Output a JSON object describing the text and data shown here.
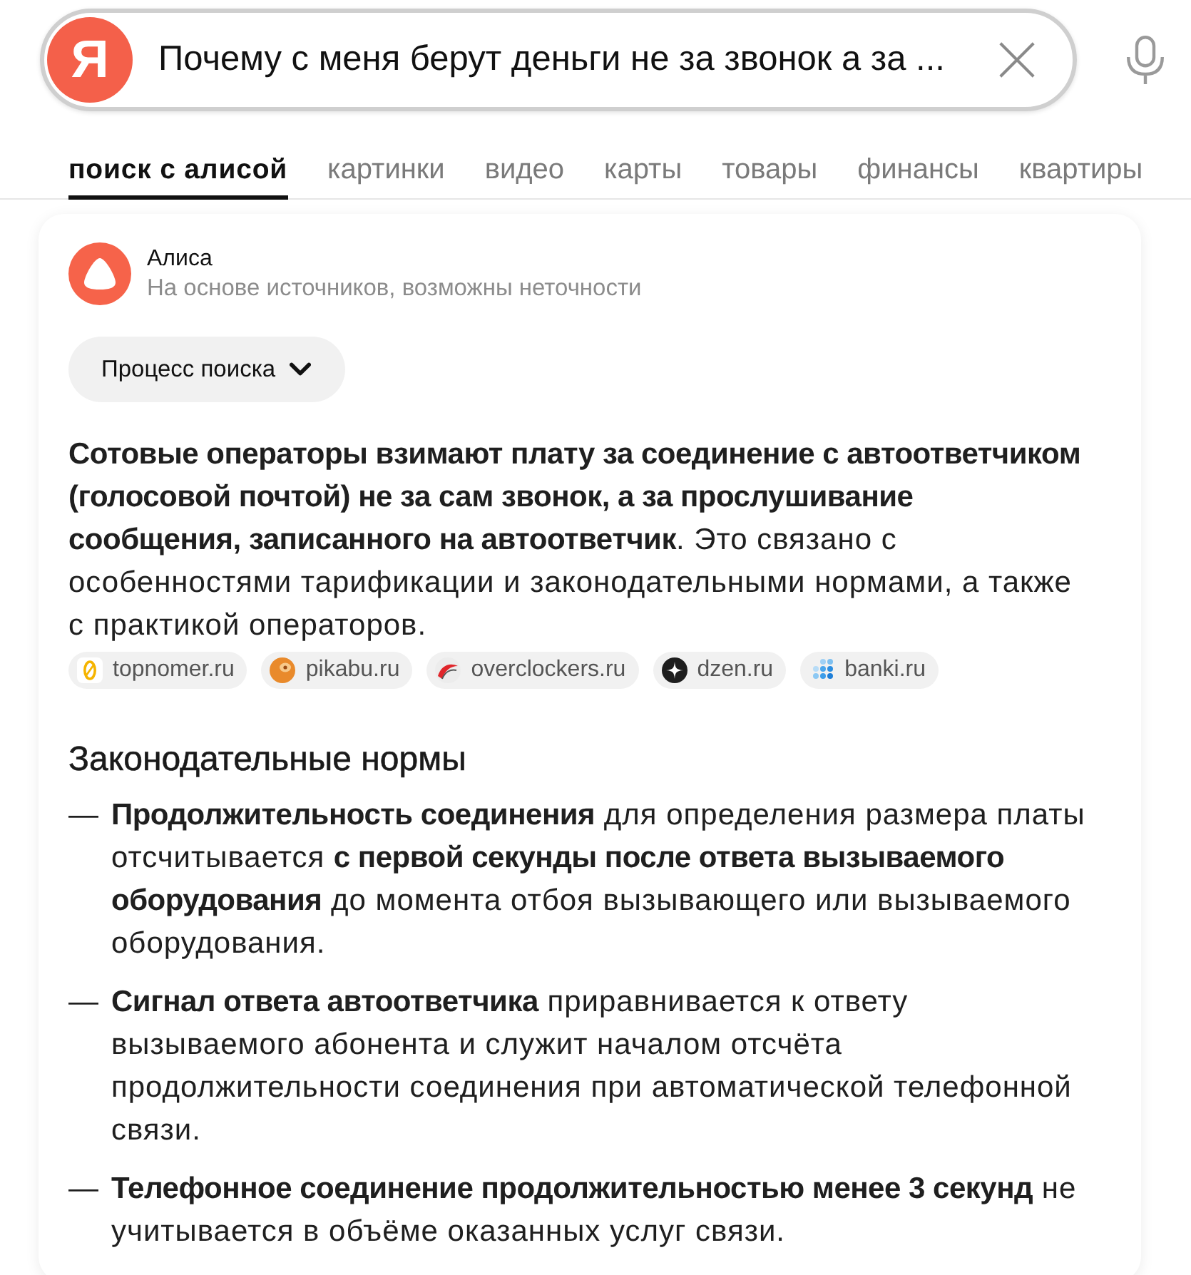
{
  "search": {
    "logo": "Я",
    "query": "Почему с меня берут деньги не за звонок а за ..."
  },
  "tabs": [
    {
      "label": "поиск с алисой",
      "selected": true
    },
    {
      "label": "картинки",
      "selected": false
    },
    {
      "label": "видео",
      "selected": false
    },
    {
      "label": "карты",
      "selected": false
    },
    {
      "label": "товары",
      "selected": false
    },
    {
      "label": "финансы",
      "selected": false
    },
    {
      "label": "квартиры",
      "selected": false
    }
  ],
  "answer": {
    "author": "Алиса",
    "note": "На основе источников, возможны неточности",
    "process_button": "Процесс поиска",
    "summary": "**Сотовые операторы взимают плату за соединение с автоответчиком (голосовой почтой) не за сам звонок, а за прослушивание сообщения, записанного на автоответчик**. Это связано с особенностями тарификации и законодательными нормами, а также с практикой операторов.",
    "sources": [
      {
        "label": "topnomer.ru",
        "kind": "zero"
      },
      {
        "label": "pikabu.ru",
        "kind": "bun"
      },
      {
        "label": "overclockers.ru",
        "kind": "swoosh"
      },
      {
        "label": "dzen.ru",
        "kind": "star"
      },
      {
        "label": "banki.ru",
        "kind": "dots"
      }
    ],
    "section_title": "Законодательные нормы",
    "items": [
      {
        "marker": "—",
        "text": "**Продолжительность соединения** для определения размера платы отсчитывается **с первой секунды после ответа вызываемого оборудования** до момента отбоя вызывающего или вызываемого оборудования."
      },
      {
        "marker": "—",
        "text": "**Сигнал ответа автоответчика** приравнивается к ответу вызываемого абонента и служит началом отсчёта продолжительности соединения при автоматической телефонной связи."
      },
      {
        "marker": "—",
        "text": "**Телефонное соединение продолжительностью менее 3 секунд** не учитывается в объёме оказанных услуг связи."
      }
    ]
  }
}
